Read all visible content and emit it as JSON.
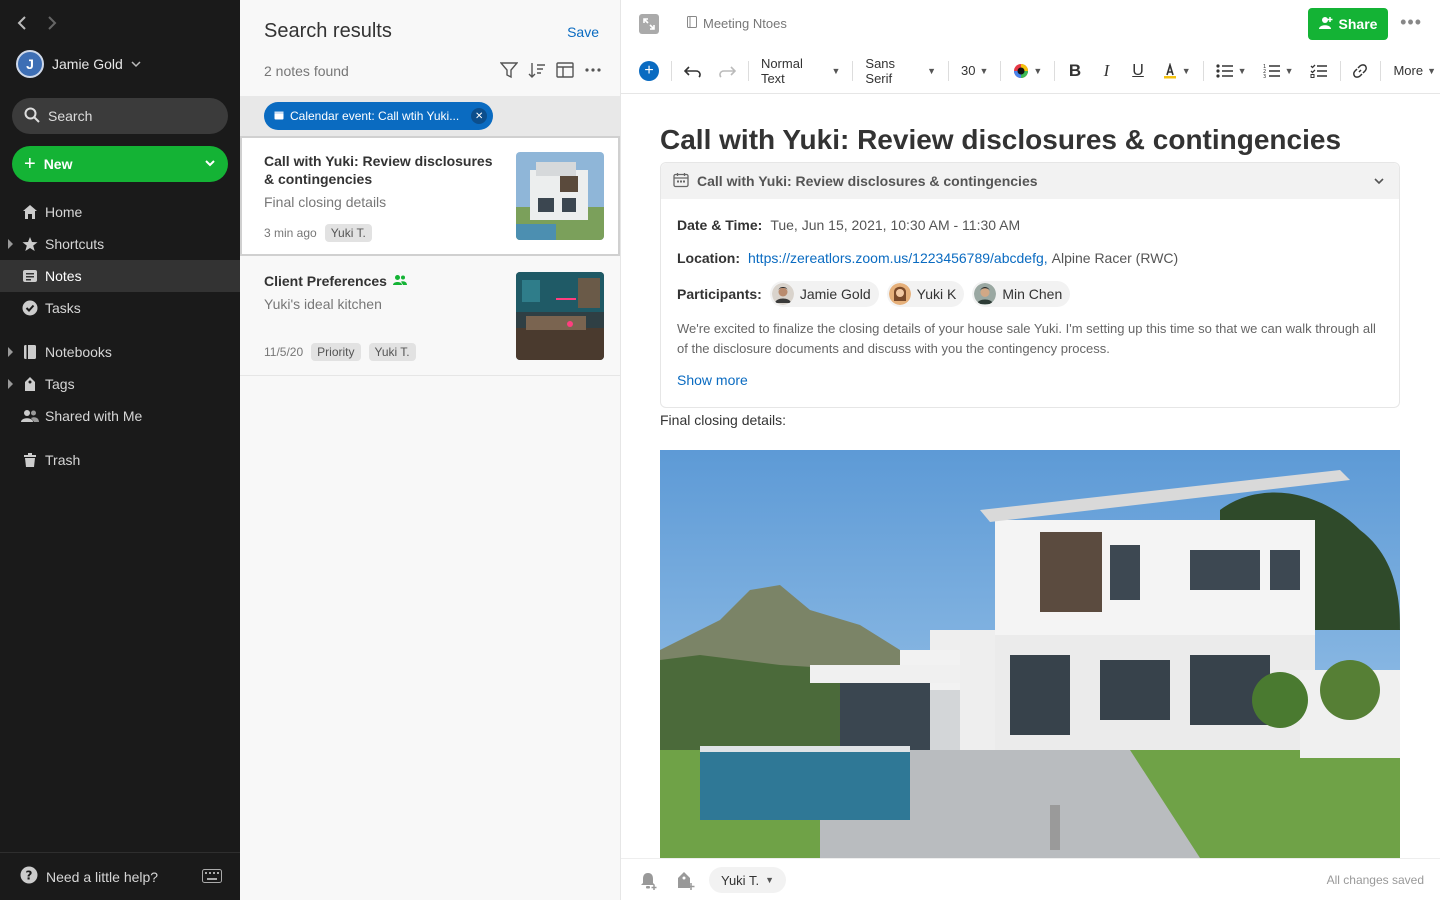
{
  "sidebar": {
    "user_name": "Jamie Gold",
    "avatar_initial": "J",
    "search_label": "Search",
    "new_label": "New",
    "nav": [
      {
        "label": "Home",
        "icon": "home-icon"
      },
      {
        "label": "Shortcuts",
        "icon": "star-icon"
      },
      {
        "label": "Notes",
        "icon": "notes-icon"
      },
      {
        "label": "Tasks",
        "icon": "task-check-icon"
      },
      {
        "label": "Notebooks",
        "icon": "notebook-icon"
      },
      {
        "label": "Tags",
        "icon": "tag-icon"
      },
      {
        "label": "Shared with Me",
        "icon": "people-icon"
      },
      {
        "label": "Trash",
        "icon": "trash-icon"
      }
    ],
    "help_label": "Need a little help?"
  },
  "middle": {
    "title": "Search results",
    "save_label": "Save",
    "count": "2 notes found",
    "filter_chip": "Calendar event: Call wtih Yuki...",
    "notes": [
      {
        "title": "Call with Yuki: Review disclosures & contingencies",
        "snippet": "Final closing details",
        "time": "3 min ago",
        "tags": [
          "Yuki T."
        ]
      },
      {
        "title": "Client Preferences",
        "snippet": "Yuki's ideal kitchen",
        "time": "11/5/20",
        "tags": [
          "Priority",
          "Yuki T."
        ]
      }
    ]
  },
  "editor": {
    "breadcrumb": "Meeting Ntoes",
    "share_label": "Share",
    "toolbar": {
      "style": "Normal Text",
      "font": "Sans Serif",
      "size": "30",
      "more": "More"
    },
    "title": "Call with Yuki: Review disclosures & contingencies",
    "event": {
      "header": "Call with Yuki: Review disclosures & contingencies",
      "date_label": "Date & Time:",
      "date_value": "Tue, Jun 15, 2021, 10:30 AM - 11:30 AM",
      "location_label": "Location:",
      "location_link": "https://zereatlors.zoom.us/1223456789/abcdefg,",
      "location_rest": "Alpine Racer (RWC)",
      "participants_label": "Participants:",
      "participants": [
        "Jamie Gold",
        "Yuki K",
        "Min Chen"
      ],
      "description": "We're excited to finalize the closing details of your house sale Yuki. I'm setting up this time so that we can walk through all of the disclosure documents and discuss with you the contingency process.",
      "show_more": "Show more"
    },
    "body_text": "Final  closing details:",
    "owner": "Yuki T.",
    "status": "All changes saved"
  },
  "colors": {
    "accent_green": "#14b335",
    "link_blue": "#0a6bc1",
    "sidebar_bg": "#1a1a1a"
  }
}
